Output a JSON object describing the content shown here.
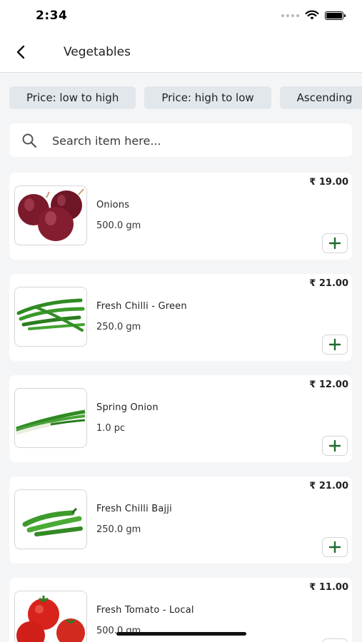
{
  "status_bar": {
    "time": "2:34"
  },
  "header": {
    "title": "Vegetables"
  },
  "sort_chips": [
    {
      "label": "Price: low to high"
    },
    {
      "label": "Price: high to low"
    },
    {
      "label": "Ascending"
    }
  ],
  "search": {
    "placeholder": "Search item here..."
  },
  "products": [
    {
      "name": "Onions",
      "qty": "500.0 gm",
      "price": "₹ 19.00",
      "image": "onions"
    },
    {
      "name": "Fresh Chilli - Green",
      "qty": "250.0 gm",
      "price": "₹ 21.00",
      "image": "green-chilli"
    },
    {
      "name": "Spring Onion",
      "qty": "1.0 pc",
      "price": "₹ 12.00",
      "image": "spring-onion"
    },
    {
      "name": "Fresh Chilli Bajji",
      "qty": "250.0 gm",
      "price": "₹ 21.00",
      "image": "bajji-chilli"
    },
    {
      "name": "Fresh Tomato - Local",
      "qty": "500.0 gm",
      "price": "₹ 11.00",
      "image": "tomato"
    }
  ],
  "colors": {
    "add_icon": "#1d6b2d",
    "chip_bg": "#e2e7ec",
    "page_bg": "#f4f5f7"
  }
}
